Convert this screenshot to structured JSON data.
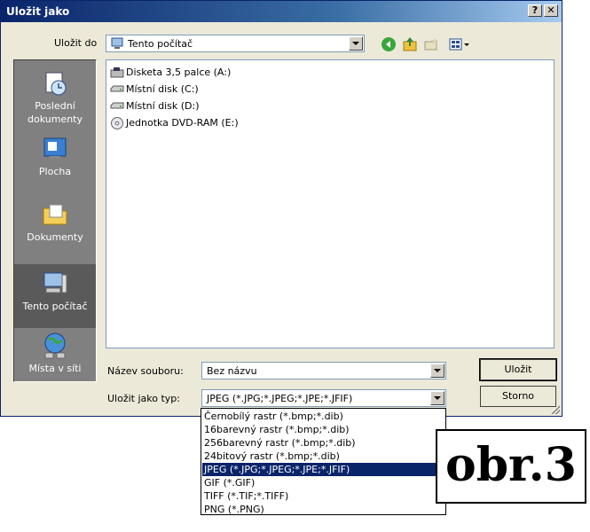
{
  "dialog": {
    "title": "Uložit jako",
    "help_label": "?",
    "close_label": "✕"
  },
  "save_in": {
    "label": "Uložit do",
    "value": "Tento počítač"
  },
  "places": [
    {
      "line1": "Poslední",
      "line2": "dokumenty",
      "icon": "recent-documents-icon"
    },
    {
      "line1": "Plocha",
      "line2": "",
      "icon": "desktop-icon"
    },
    {
      "line1": "Dokumenty",
      "line2": "",
      "icon": "my-documents-icon"
    },
    {
      "line1": "Tento počítač",
      "line2": "",
      "icon": "my-computer-icon"
    },
    {
      "line1": "Místa v síti",
      "line2": "",
      "icon": "network-places-icon"
    }
  ],
  "files": [
    {
      "name": "Disketa 3,5 palce (A:)",
      "icon": "floppy-drive-icon"
    },
    {
      "name": "Místní disk (C:)",
      "icon": "hard-drive-icon"
    },
    {
      "name": "Místní disk (D:)",
      "icon": "hard-drive-icon"
    },
    {
      "name": "Jednotka DVD-RAM (E:)",
      "icon": "dvd-drive-icon"
    }
  ],
  "filename": {
    "label": "Název souboru:",
    "value": "Bez názvu"
  },
  "filetype": {
    "label": "Uložit jako typ:",
    "value": "JPEG (*.JPG;*.JPEG;*.JPE;*.JFIF)",
    "options": [
      "Černobílý rastr (*.bmp;*.dib)",
      "16barevný rastr (*.bmp;*.dib)",
      "256barevný rastr (*.bmp;*.dib)",
      "24bitový rastr (*.bmp;*.dib)",
      "JPEG (*.JPG;*.JPEG;*.JPE;*.JFIF)",
      "GIF (*.GIF)",
      "TIFF (*.TIF;*.TIFF)",
      "PNG (*.PNG)"
    ],
    "selected_index": 4
  },
  "buttons": {
    "save": "Uložit",
    "cancel": "Storno"
  },
  "caption": "obr.3"
}
